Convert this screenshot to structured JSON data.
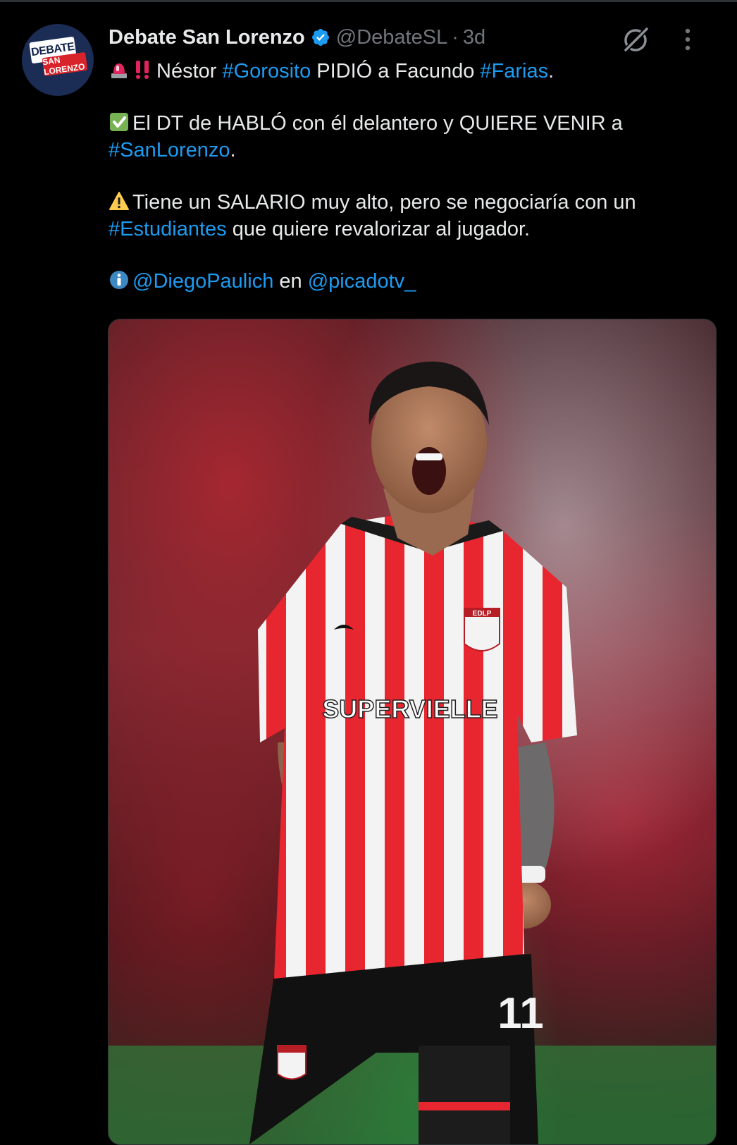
{
  "account": {
    "display_name": "Debate San Lorenzo",
    "handle": "@DebateSL",
    "separator": "·",
    "time": "3d",
    "avatar_text_top": "DEBATE",
    "avatar_text_bottom": "SAN LORENZO"
  },
  "tweet": {
    "line1": {
      "text_1": "Néstor ",
      "hashtag_1": "#Gorosito",
      "text_2": " PIDIÓ a Facundo ",
      "hashtag_2": "#Farias",
      "text_3": "."
    },
    "line2": {
      "text_1": "El DT de HABLÓ con él delantero y QUIERE VENIR a ",
      "hashtag_1": "#SanLorenzo",
      "text_2": "."
    },
    "line3": {
      "text_1": "Tiene un SALARIO muy alto, pero se negociaría con un ",
      "hashtag_1": "#Estudiantes",
      "text_2": " que quiere revalorizar al jugador."
    },
    "line4": {
      "mention_1": "@DiegoPaulich",
      "text_1": " en ",
      "mention_2": "@picadotv_"
    }
  },
  "media": {
    "sponsor": "SUPERVIELLE",
    "badge": "EDLP",
    "number": "11"
  },
  "icons": {
    "verified": "verified-badge-icon",
    "grok": "grok-icon",
    "more": "more-options-icon",
    "siren": "police-light-emoji",
    "exclamation": "double-exclamation-emoji",
    "check": "check-mark-button-emoji",
    "warning": "warning-emoji",
    "info": "information-emoji"
  },
  "colors": {
    "background": "#000000",
    "text": "#e7e9ea",
    "secondary": "#71767b",
    "link": "#1d9bf0",
    "verified": "#1d9bf0"
  }
}
